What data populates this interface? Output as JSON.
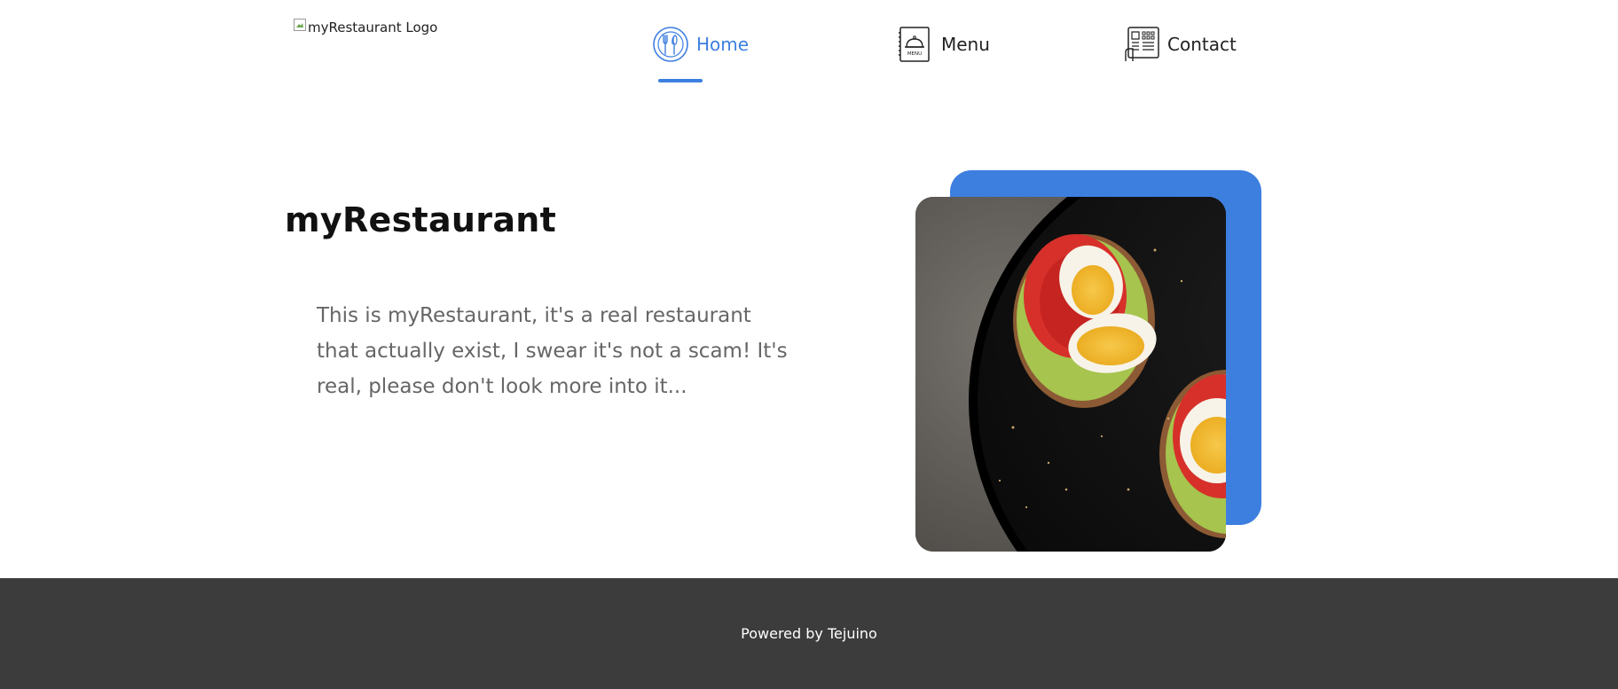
{
  "header": {
    "logo_alt": "myRestaurant Logo",
    "nav": {
      "home": {
        "label": "Home",
        "icon": "plate-cutlery-icon",
        "active": true
      },
      "menu": {
        "label": "Menu",
        "icon": "menu-book-icon"
      },
      "contact": {
        "label": "Contact",
        "icon": "phone-contact-icon"
      }
    }
  },
  "hero": {
    "title": "myRestaurant",
    "description": "This is myRestaurant, it's a real restaurant that actually exist, I swear it's not a scam! It's real, please don't look more into it...",
    "image": "food-photo"
  },
  "footer": {
    "text": "Powered by Tejuino"
  },
  "colors": {
    "accent": "#3d7fdf",
    "footer_bg": "#3c3c3c",
    "title": "#111111",
    "body_text": "#666666"
  }
}
